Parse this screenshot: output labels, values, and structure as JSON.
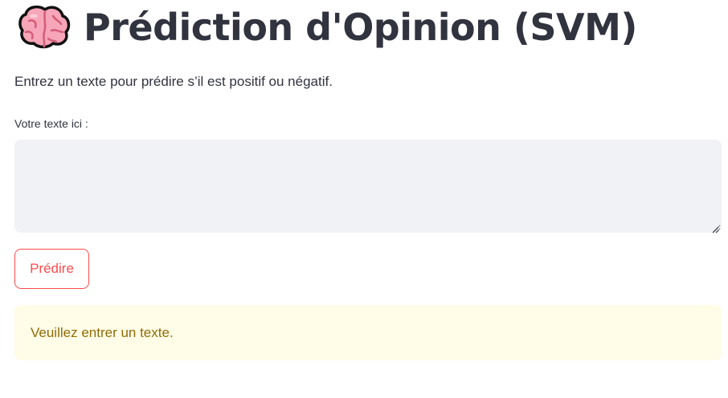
{
  "header": {
    "icon": "brain-icon",
    "title": "Prédiction d'Opinion (SVM)"
  },
  "main": {
    "subtitle": "Entrez un texte pour prédire s’il est positif ou négatif.",
    "text_input": {
      "label": "Votre texte ici :",
      "value": "",
      "placeholder": ""
    },
    "predict_button": {
      "label": "Prédire"
    },
    "warning": {
      "text": "Veuillez entrer un texte."
    }
  },
  "colors": {
    "text": "#31333f",
    "accent": "#ff4b4b",
    "input_background": "#f0f2f6",
    "warning_background": "#fffce7",
    "warning_text": "#926c05"
  }
}
